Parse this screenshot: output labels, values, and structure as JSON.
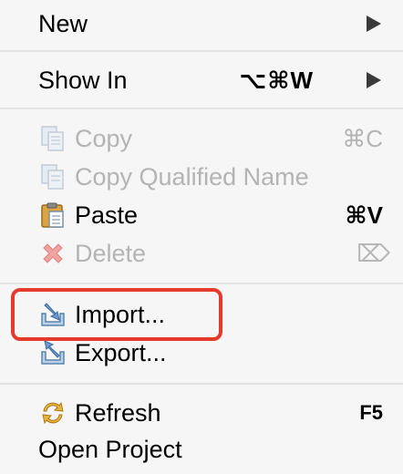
{
  "menu": {
    "new": {
      "label": "New",
      "has_submenu": true
    },
    "show_in": {
      "label": "Show In",
      "shortcut": "⌥⌘W",
      "has_submenu": true
    },
    "copy": {
      "label": "Copy",
      "shortcut": "⌘C",
      "enabled": false,
      "icon": "copy-icon"
    },
    "copy_qualified": {
      "label": "Copy Qualified Name",
      "enabled": false,
      "icon": "copy-qualified-name-icon"
    },
    "paste": {
      "label": "Paste",
      "shortcut": "⌘V",
      "enabled": true,
      "icon": "paste-icon"
    },
    "delete": {
      "label": "Delete",
      "shortcut": "⌦",
      "enabled": false,
      "icon": "delete-icon"
    },
    "import": {
      "label": "Import...",
      "icon": "import-icon",
      "highlighted": true
    },
    "export": {
      "label": "Export...",
      "icon": "export-icon"
    },
    "refresh": {
      "label": "Refresh",
      "shortcut": "F5",
      "icon": "refresh-icon"
    },
    "open_project": {
      "label": "Open Project"
    }
  },
  "colors": {
    "background": "#f6f6f6",
    "disabled_text": "#b4b4b4",
    "highlight_border": "#e53a2e",
    "separator": "#e2e2e2"
  }
}
